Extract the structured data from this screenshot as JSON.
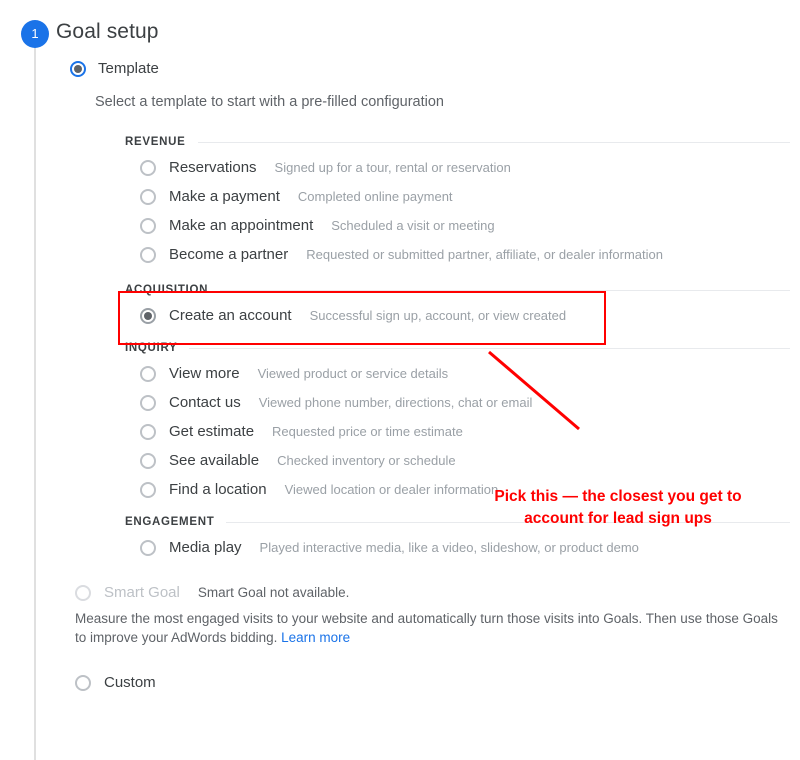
{
  "step": {
    "number": "1",
    "title": "Goal setup",
    "badge_color": "#1a73e8"
  },
  "goal_type": {
    "template": {
      "label": "Template",
      "selected": true,
      "help_text": "Select a template to start with a pre-filled configuration"
    },
    "smart_goal": {
      "label": "Smart Goal",
      "note": "Smart Goal not available.",
      "description": "Measure the most engaged visits to your website and automatically turn those visits into Goals. Then use those Goals to improve your AdWords bidding.",
      "learn_more_label": "Learn more",
      "disabled": true
    },
    "custom": {
      "label": "Custom",
      "selected": false
    }
  },
  "template_groups": [
    {
      "title": "REVENUE",
      "options": [
        {
          "name": "Reservations",
          "description": "Signed up for a tour, rental or reservation",
          "selected": false
        },
        {
          "name": "Make a payment",
          "description": "Completed online payment",
          "selected": false
        },
        {
          "name": "Make an appointment",
          "description": "Scheduled a visit or meeting",
          "selected": false
        },
        {
          "name": "Become a partner",
          "description": "Requested or submitted partner, affiliate, or dealer information",
          "selected": false
        }
      ]
    },
    {
      "title": "ACQUISITION",
      "options": [
        {
          "name": "Create an account",
          "description": "Successful sign up, account, or view created",
          "selected": true
        }
      ]
    },
    {
      "title": "INQUIRY",
      "options": [
        {
          "name": "View more",
          "description": "Viewed product or service details",
          "selected": false
        },
        {
          "name": "Contact us",
          "description": "Viewed phone number, directions, chat or email",
          "selected": false
        },
        {
          "name": "Get estimate",
          "description": "Requested price or time estimate",
          "selected": false
        },
        {
          "name": "See available",
          "description": "Checked inventory or schedule",
          "selected": false
        },
        {
          "name": "Find a location",
          "description": "Viewed location or dealer information",
          "selected": false
        }
      ]
    },
    {
      "title": "ENGAGEMENT",
      "options": [
        {
          "name": "Media play",
          "description": "Played interactive media, like a video, slideshow, or product demo",
          "selected": false
        }
      ]
    }
  ],
  "annotations": {
    "color": "#ff0000",
    "callout_line1": "Pick this — the closest you get to",
    "callout_line2": "account for lead sign ups",
    "highlight_target": "ACQUISITION"
  }
}
